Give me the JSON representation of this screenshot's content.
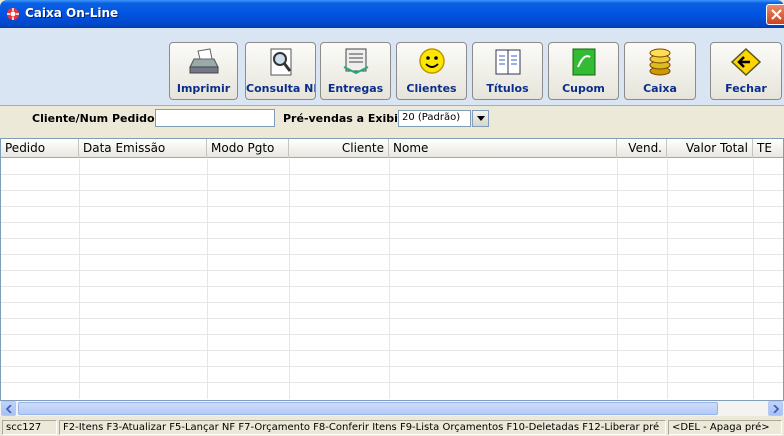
{
  "window": {
    "title": "Caixa On-Line",
    "close_label": "Close"
  },
  "toolbar": {
    "buttons": [
      {
        "label": "Imprimir",
        "icon": "printer-icon"
      },
      {
        "label": "Consulta NF",
        "icon": "magnifier-document-icon"
      },
      {
        "label": "Entregas",
        "icon": "delivery-icon"
      },
      {
        "label": "Clientes",
        "icon": "smiley-icon"
      },
      {
        "label": "Títulos",
        "icon": "book-icon"
      },
      {
        "label": "Cupom",
        "icon": "receipt-icon"
      },
      {
        "label": "Caixa",
        "icon": "coins-icon"
      },
      {
        "label": "Fechar",
        "icon": "exit-arrow-icon"
      }
    ]
  },
  "filter": {
    "cliente_label": "Cliente/Num Pedido",
    "cliente_value": "",
    "prevendas_label": "Pré-vendas a Exibir?",
    "prevendas_value": "20 (Padrão)"
  },
  "grid": {
    "columns": [
      "Pedido",
      "Data Emissão",
      "Modo Pgto",
      "Cliente",
      "Nome",
      "Vend.",
      "Valor Total",
      "TE"
    ],
    "rows": []
  },
  "statusbar": {
    "panels": [
      "scc127",
      "F2-Itens  F3-Atualizar  F5-Lançar NF  F7-Orçamento  F8-Conferir Itens  F9-Lista Orçamentos  F10-Deletadas  F12-Liberar pré",
      "<DEL - Apaga pré>"
    ]
  },
  "colors": {
    "titlebar": "#0054e3",
    "toolbar_bg": "#d9e5f3",
    "button_label": "#0a2e8a",
    "window_bg": "#ece9d8"
  }
}
